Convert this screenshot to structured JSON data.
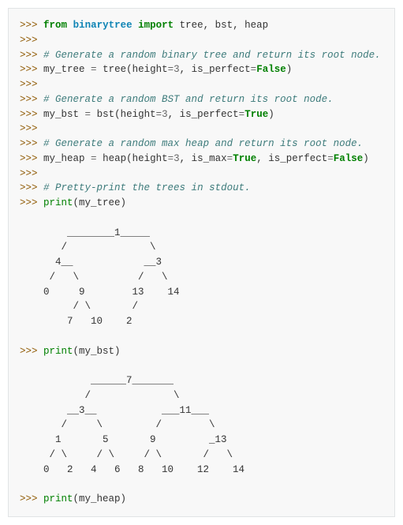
{
  "prompt_primary": ">>>",
  "line1": {
    "kw_from": "from",
    "module": "binarytree",
    "kw_import": "import",
    "names": "tree, bst, heap"
  },
  "comments": {
    "c1": "# Generate a random binary tree and return its root node.",
    "c2": "# Generate a random BST and return its root node.",
    "c3": "# Generate a random max heap and return its root node.",
    "c4": "# Pretty-print the trees in stdout."
  },
  "stmt_tree": {
    "var": "my_tree",
    "eq": " = ",
    "func": "tree",
    "open": "(",
    "kw1": "height",
    "eq1": "=",
    "val1": "3",
    "comma1": ", ",
    "kw2": "is_perfect",
    "eq2": "=",
    "val2": "False",
    "close": ")"
  },
  "stmt_bst": {
    "var": "my_bst",
    "eq": " = ",
    "func": "bst",
    "open": "(",
    "kw1": "height",
    "eq1": "=",
    "val1": "3",
    "comma1": ", ",
    "kw2": "is_perfect",
    "eq2": "=",
    "val2": "True",
    "close": ")"
  },
  "stmt_heap": {
    "var": "my_heap",
    "eq": " = ",
    "func": "heap",
    "open": "(",
    "kw1": "height",
    "eq1": "=",
    "val1": "3",
    "comma1": ", ",
    "kw2": "is_max",
    "eq2": "=",
    "val2": "True",
    "comma2": ", ",
    "kw3": "is_perfect",
    "eq3": "=",
    "val3": "False",
    "close": ")"
  },
  "prints": {
    "p1_fn": "print",
    "p1_arg": "(my_tree)",
    "p2_fn": "print",
    "p2_arg": "(my_bst)",
    "p3_fn": "print",
    "p3_arg": "(my_heap)"
  },
  "tree_output_1": "\n        ________1_____\n       /              \\\n      4__            __3\n     /   \\          /   \\\n    0     9        13    14\n         / \\       /\n        7   10    2\n",
  "tree_output_2": "\n            ______7_______\n           /              \\\n        __3__           ___11___\n       /     \\         /        \\\n      1       5       9         _13\n     / \\     / \\     / \\       /   \\\n    0   2   4   6   8   10    12    14\n"
}
